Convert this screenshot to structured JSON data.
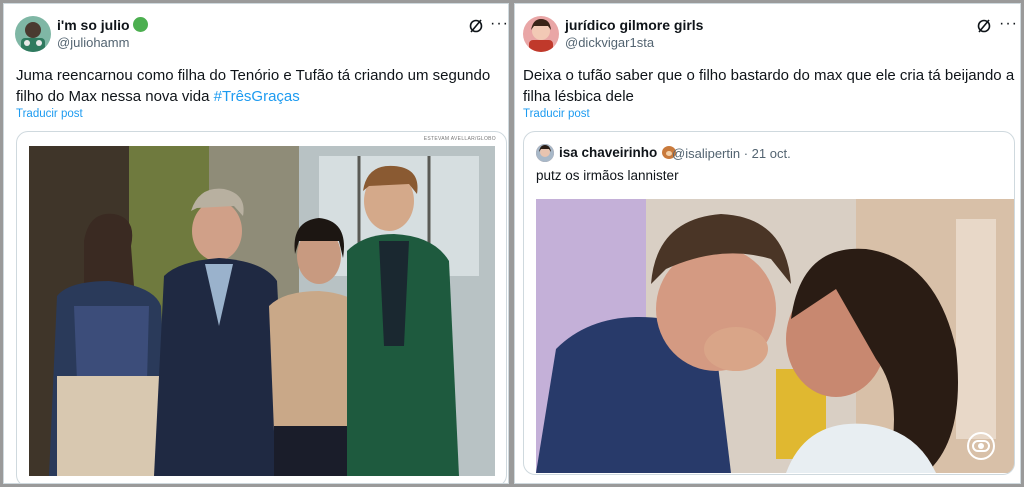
{
  "left_post": {
    "display_name": "i'm so julio",
    "handle": "@juliohamm",
    "text": "Juma reencarnou como filha do Tenório e Tufão tá criando um segundo filho do Max nessa nova vida",
    "hashtag": "#TrêsGraças",
    "translate": "Traducir post",
    "more_label": "···",
    "photo_credit": "ESTEVAM AVELLAR/GLOBO"
  },
  "right_post": {
    "display_name": "jurídico gilmore girls",
    "handle": "@dickvigar1sta",
    "text": "Deixa o tufão saber que o filho bastardo do max que ele cria tá beijando a filha lésbica dele",
    "translate": "Traducir post",
    "more_label": "···",
    "quote": {
      "display_name": "isa chaveirinho",
      "handle_and_date": "@isalipertin · 21 oct.",
      "text": "putz os irmãos lannister"
    }
  },
  "colors": {
    "link": "#1d9bf0",
    "verified": "#4caf50",
    "muted": "#536471",
    "border": "#cfd9de"
  },
  "icons": [
    "grok-icon",
    "more-icon",
    "globo-logo-icon",
    "bear-emoji-icon",
    "verified-circle-icon"
  ]
}
